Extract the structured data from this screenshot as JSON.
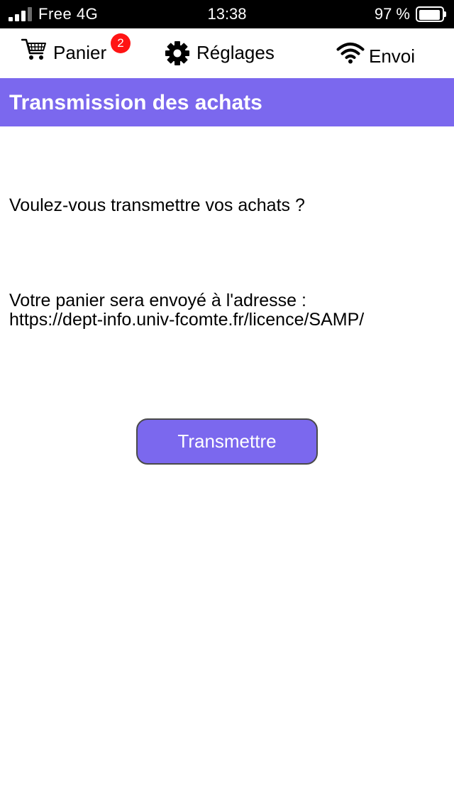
{
  "status_bar": {
    "carrier": "Free 4G",
    "time": "13:38",
    "battery_percent": "97 %",
    "battery_level": 0.97,
    "signal_bars": 3,
    "signal_bars_total": 4
  },
  "toolbar": {
    "cart": {
      "label": "Panier",
      "badge": "2",
      "icon": "cart-icon"
    },
    "settings": {
      "label": "Réglages",
      "icon": "gear-icon"
    },
    "send": {
      "label": "Envoi",
      "icon": "wifi-icon"
    }
  },
  "header": {
    "title": "Transmission des achats"
  },
  "main": {
    "question": "Voulez-vous transmettre vos achats ?",
    "destination_line1": "Votre panier sera envoyé à l'adresse :",
    "destination_url": "https://dept-info.univ-fcomte.fr/licence/SAMP/",
    "submit_label": "Transmettre"
  },
  "colors": {
    "accent": "#7b68ee",
    "badge": "#ff1414",
    "status_bar_bg": "#000000",
    "button_border": "#4a4a4a"
  }
}
